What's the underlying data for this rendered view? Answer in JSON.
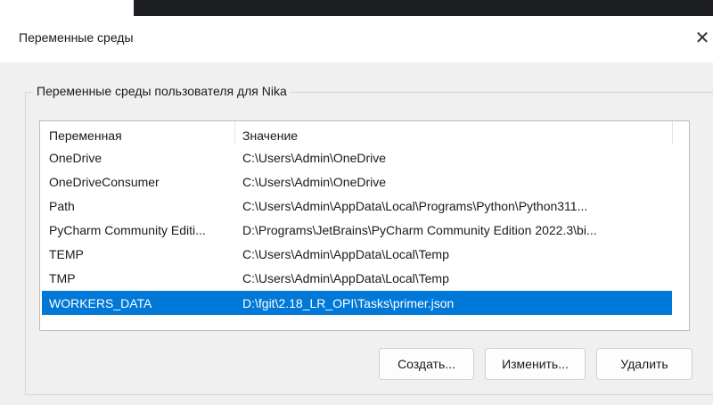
{
  "dialog": {
    "title": "Переменные среды",
    "close_glyph": "✕"
  },
  "user_vars": {
    "group_label": "Переменные среды пользователя для Nika",
    "columns": [
      "Переменная",
      "Значение"
    ],
    "rows": [
      {
        "name": "OneDrive",
        "value": "C:\\Users\\Admin\\OneDrive"
      },
      {
        "name": "OneDriveConsumer",
        "value": "C:\\Users\\Admin\\OneDrive"
      },
      {
        "name": "Path",
        "value": "C:\\Users\\Admin\\AppData\\Local\\Programs\\Python\\Python311..."
      },
      {
        "name": "PyCharm Community Editi...",
        "value": "D:\\Programs\\JetBrains\\PyCharm Community Edition 2022.3\\bi..."
      },
      {
        "name": "TEMP",
        "value": "C:\\Users\\Admin\\AppData\\Local\\Temp"
      },
      {
        "name": "TMP",
        "value": "C:\\Users\\Admin\\AppData\\Local\\Temp"
      },
      {
        "name": "WORKERS_DATA",
        "value": "D:\\fgit\\2.18_LR_OPI\\Tasks\\primer.json"
      }
    ],
    "selected_row": "WORKERS_DATA"
  },
  "buttons": {
    "create": "Создать...",
    "edit": "Изменить...",
    "delete": "Удалить"
  },
  "colors": {
    "selection": "#0078d7",
    "background_editor": "#1e1f22"
  }
}
